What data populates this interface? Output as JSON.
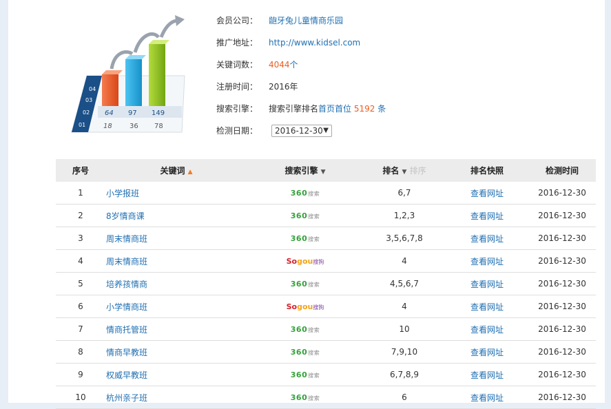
{
  "profile": {
    "company_label": "会员公司：",
    "company_value": "龅牙兔儿童情商乐园",
    "url_label": "推广地址：",
    "url_value": "http://www.kidsel.com",
    "kwcount_label": "关键词数：",
    "kwcount_value": "4044",
    "kwcount_unit": "个",
    "reg_label": "注册时间：",
    "reg_value": "2016年",
    "engine_label": "搜索引擎：",
    "engine_prefix": "搜索引擎排名",
    "engine_link": "首页首位",
    "engine_count": "5192",
    "engine_suffix": "条",
    "date_label": "检测日期：",
    "date_value": "2016-12-30"
  },
  "illustration": {
    "back_labels": [
      "04",
      "03",
      "02",
      "01"
    ],
    "row1": [
      "64",
      "97",
      "149"
    ],
    "row2": [
      "18",
      "36",
      "78"
    ],
    "colors": {
      "red": "#ec5a2e",
      "blue": "#2aa7de",
      "green": "#8fc21f",
      "navy": "#1a4f87"
    }
  },
  "table": {
    "headers": {
      "idx": "序号",
      "keyword": "关键词",
      "engine": "搜索引擎",
      "rank": "排名",
      "rank_extra": "排序",
      "snapshot": "排名快照",
      "date": "检测时间"
    },
    "rows": [
      {
        "idx": "1",
        "keyword": "小学报班",
        "engine": "360",
        "rank": "6,7",
        "snapshot": "查看网址",
        "date": "2016-12-30"
      },
      {
        "idx": "2",
        "keyword": "8岁情商课",
        "engine": "360",
        "rank": "1,2,3",
        "snapshot": "查看网址",
        "date": "2016-12-30"
      },
      {
        "idx": "3",
        "keyword": "周末情商班",
        "engine": "360",
        "rank": "3,5,6,7,8",
        "snapshot": "查看网址",
        "date": "2016-12-30"
      },
      {
        "idx": "4",
        "keyword": "周末情商班",
        "engine": "sogou",
        "rank": "4",
        "snapshot": "查看网址",
        "date": "2016-12-30"
      },
      {
        "idx": "5",
        "keyword": "培养孩情商",
        "engine": "360",
        "rank": "4,5,6,7",
        "snapshot": "查看网址",
        "date": "2016-12-30"
      },
      {
        "idx": "6",
        "keyword": "小学情商班",
        "engine": "sogou",
        "rank": "4",
        "snapshot": "查看网址",
        "date": "2016-12-30"
      },
      {
        "idx": "7",
        "keyword": "情商托管班",
        "engine": "360",
        "rank": "10",
        "snapshot": "查看网址",
        "date": "2016-12-30"
      },
      {
        "idx": "8",
        "keyword": "情商早教班",
        "engine": "360",
        "rank": "7,9,10",
        "snapshot": "查看网址",
        "date": "2016-12-30"
      },
      {
        "idx": "9",
        "keyword": "权威早教班",
        "engine": "360",
        "rank": "6,7,8,9",
        "snapshot": "查看网址",
        "date": "2016-12-30"
      },
      {
        "idx": "10",
        "keyword": "杭州亲子班",
        "engine": "360",
        "rank": "6",
        "snapshot": "查看网址",
        "date": "2016-12-30"
      }
    ]
  },
  "logos": {
    "l360_main": "360",
    "l360_sub": "搜索",
    "sogou_a": "So",
    "sogou_b": "gou",
    "sogou_sub": "搜狗"
  }
}
